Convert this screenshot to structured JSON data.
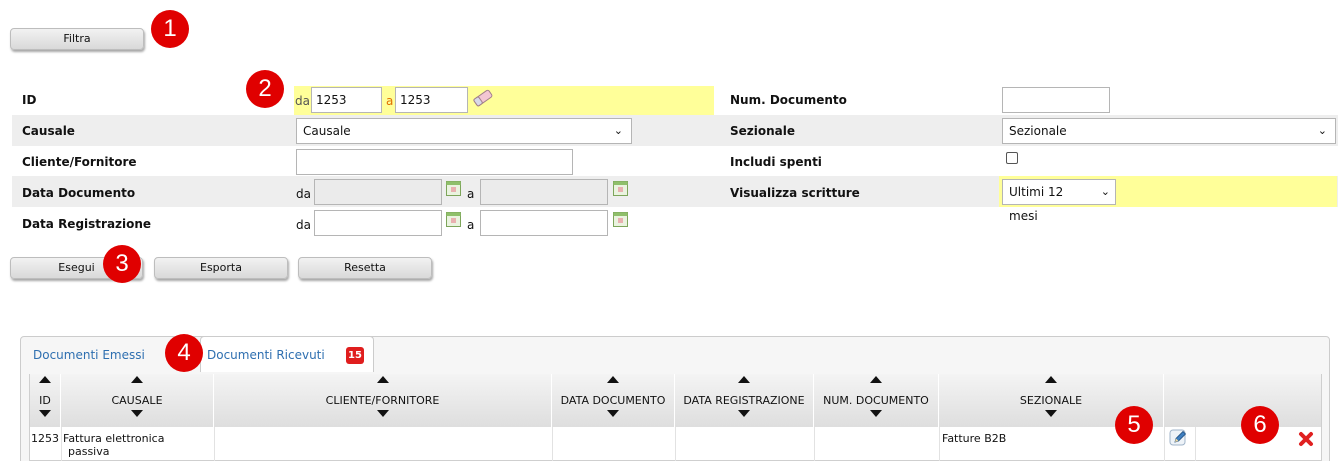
{
  "toolbar": {
    "filtra_label": "Filtra"
  },
  "callouts": [
    "1",
    "2",
    "3",
    "4",
    "5",
    "6"
  ],
  "filters": {
    "id": {
      "label": "ID",
      "from_prefix": "da",
      "from_value": "1253",
      "to_prefix": "a",
      "to_value": "1253"
    },
    "causale": {
      "label": "Causale",
      "selected": "Causale"
    },
    "cliente": {
      "label": "Cliente/Fornitore",
      "value": ""
    },
    "data_documento": {
      "label": "Data Documento",
      "from_prefix": "da",
      "to_prefix": "a"
    },
    "data_registrazione": {
      "label": "Data Registrazione",
      "from_prefix": "da",
      "to_prefix": "a"
    },
    "num_documento": {
      "label": "Num. Documento",
      "value": ""
    },
    "sezionale": {
      "label": "Sezionale",
      "selected": "Sezionale"
    },
    "includi_spenti": {
      "label": "Includi spenti",
      "checked": false
    },
    "visualizza_scritture": {
      "label": "Visualizza scritture",
      "selected": "Ultimi 12 mesi"
    }
  },
  "actions": {
    "esegui": "Esegui",
    "esporta": "Esporta",
    "resetta": "Resetta"
  },
  "tabs": [
    {
      "label": "Documenti Emessi",
      "active": false
    },
    {
      "label": "Documenti Ricevuti",
      "active": true,
      "count": "15"
    }
  ],
  "table": {
    "columns": [
      "ID",
      "CAUSALE",
      "CLIENTE/FORNITORE",
      "DATA DOCUMENTO",
      "DATA REGISTRAZIONE",
      "NUM. DOCUMENTO",
      "SEZIONALE"
    ],
    "rows": [
      {
        "id": "1253",
        "causale_line1": "Fattura elettronica",
        "causale_line2": "passiva",
        "cliente": "",
        "data_documento": "",
        "data_registrazione": "",
        "num_documento": "",
        "sezionale": "Fatture B2B"
      }
    ]
  },
  "colors": {
    "highlight": "#ffff99",
    "callout": "#e00000",
    "link": "#2e6fb0",
    "delete": "#e02020"
  }
}
